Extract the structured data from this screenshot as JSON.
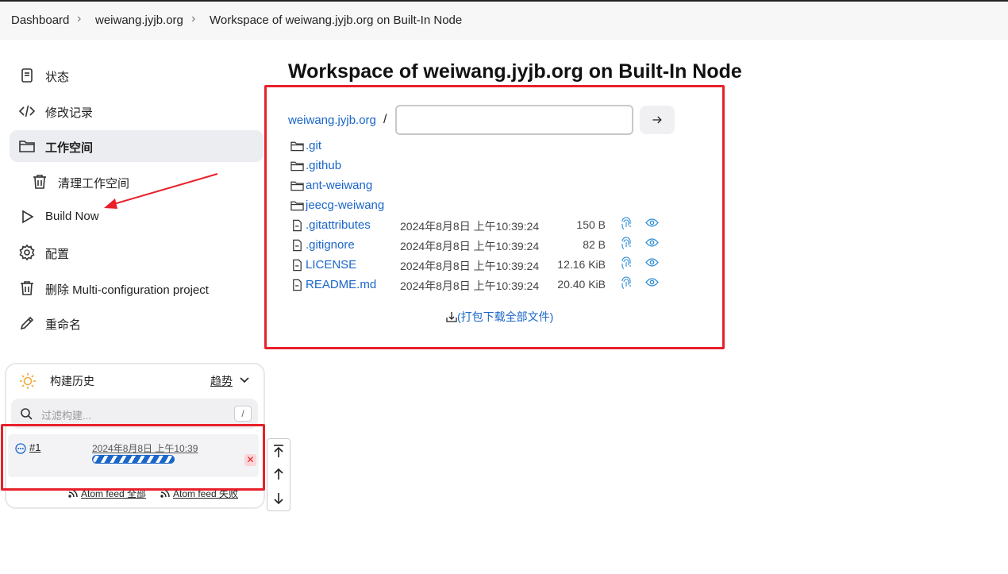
{
  "breadcrumb": {
    "items": [
      "Dashboard",
      "weiwang.jyjb.org",
      "Workspace of weiwang.jyjb.org on Built-In Node"
    ],
    "separator": ">"
  },
  "sidebar": {
    "items": [
      {
        "label": "状态",
        "icon": "document-icon"
      },
      {
        "label": "修改记录",
        "icon": "code-icon"
      },
      {
        "label": "工作空间",
        "icon": "folder-icon",
        "active": true
      },
      {
        "label": "清理工作空间",
        "icon": "trash-icon"
      },
      {
        "label": "Build Now",
        "icon": "play-icon"
      },
      {
        "label": "配置",
        "icon": "gear-icon"
      },
      {
        "label": "删除 Multi-configuration project",
        "icon": "trash-icon"
      },
      {
        "label": "重命名",
        "icon": "pencil-icon"
      }
    ]
  },
  "page": {
    "title": "Workspace of weiwang.jyjb.org on Built-In Node"
  },
  "workspace": {
    "root_link": "weiwang.jyjb.org",
    "path_separator": "/",
    "path_input_value": "",
    "go_icon": "arrow-right-icon",
    "folders": [
      ".git",
      ".github",
      "ant-weiwang",
      "jeecg-weiwang"
    ],
    "files": [
      {
        "name": ".gitattributes",
        "date": "2024年8月8日 上午10:39:24",
        "size": "150 B"
      },
      {
        "name": ".gitignore",
        "date": "2024年8月8日 上午10:39:24",
        "size": "82 B"
      },
      {
        "name": "LICENSE",
        "date": "2024年8月8日 上午10:39:24",
        "size": "12.16 KiB"
      },
      {
        "name": "README.md",
        "date": "2024年8月8日 上午10:39:24",
        "size": "20.40 KiB"
      }
    ],
    "zip_link": "(打包下载全部文件)"
  },
  "build_history": {
    "title": "构建历史",
    "trend_label": "趋势",
    "search_placeholder": "过滤构建...",
    "search_shortcut": "/",
    "builds": [
      {
        "number": "#1",
        "date": "2024年8月8日 上午10:39",
        "status": "in-progress",
        "cancel_label": "✕"
      }
    ],
    "atom_all": "Atom feed 全部",
    "atom_failed": "Atom feed 失败"
  },
  "colors": {
    "link": "#1a66c9",
    "annotation_red": "#e8202a",
    "active_bg": "#ecedf1"
  }
}
